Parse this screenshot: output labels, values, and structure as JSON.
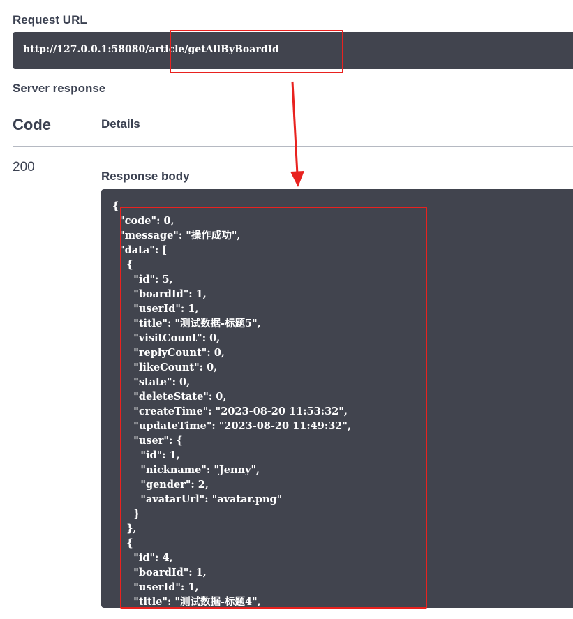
{
  "request_url": {
    "label": "Request URL",
    "value": "http://127.0.0.1:58080/article/getAllByBoardId"
  },
  "server_response": {
    "label": "Server response",
    "code_header": "Code",
    "details_header": "Details",
    "status_code": "200",
    "response_body_label": "Response body"
  },
  "response_body_lines": [
    "{",
    "  \"code\": 0,",
    "  \"message\": \"操作成功\",",
    "  \"data\": [",
    "    {",
    "      \"id\": 5,",
    "      \"boardId\": 1,",
    "      \"userId\": 1,",
    "      \"title\": \"测试数据-标题5\",",
    "      \"visitCount\": 0,",
    "      \"replyCount\": 0,",
    "      \"likeCount\": 0,",
    "      \"state\": 0,",
    "      \"deleteState\": 0,",
    "      \"createTime\": \"2023-08-20 11:53:32\",",
    "      \"updateTime\": \"2023-08-20 11:49:32\",",
    "      \"user\": {",
    "        \"id\": 1,",
    "        \"nickname\": \"Jenny\",",
    "        \"gender\": 2,",
    "        \"avatarUrl\": \"avatar.png\"",
    "      }",
    "    },",
    "    {",
    "      \"id\": 4,",
    "      \"boardId\": 1,",
    "      \"userId\": 1,",
    "      \"title\": \"测试数据-标题4\","
  ],
  "colors": {
    "annotation_red": "#e8221f",
    "code_background": "#41444e",
    "heading_text": "#3b4151"
  }
}
